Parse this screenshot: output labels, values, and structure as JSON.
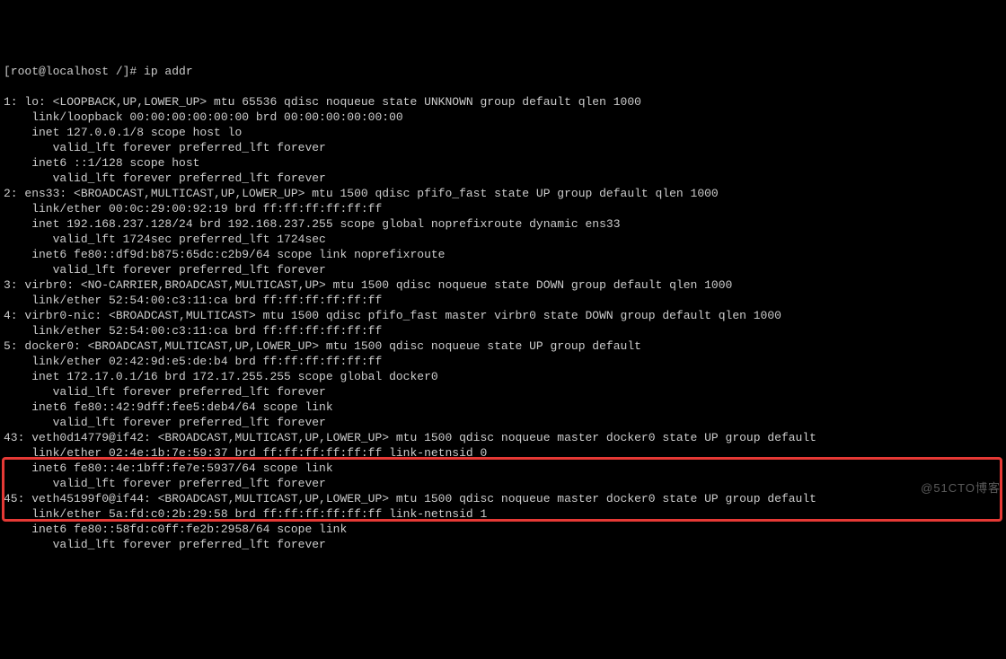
{
  "prompt": "[root@localhost /]# ip addr",
  "lines": [
    "1: lo: <LOOPBACK,UP,LOWER_UP> mtu 65536 qdisc noqueue state UNKNOWN group default qlen 1000",
    "    link/loopback 00:00:00:00:00:00 brd 00:00:00:00:00:00",
    "    inet 127.0.0.1/8 scope host lo",
    "       valid_lft forever preferred_lft forever",
    "    inet6 ::1/128 scope host",
    "       valid_lft forever preferred_lft forever",
    "2: ens33: <BROADCAST,MULTICAST,UP,LOWER_UP> mtu 1500 qdisc pfifo_fast state UP group default qlen 1000",
    "    link/ether 00:0c:29:00:92:19 brd ff:ff:ff:ff:ff:ff",
    "    inet 192.168.237.128/24 brd 192.168.237.255 scope global noprefixroute dynamic ens33",
    "       valid_lft 1724sec preferred_lft 1724sec",
    "    inet6 fe80::df9d:b875:65dc:c2b9/64 scope link noprefixroute",
    "       valid_lft forever preferred_lft forever",
    "3: virbr0: <NO-CARRIER,BROADCAST,MULTICAST,UP> mtu 1500 qdisc noqueue state DOWN group default qlen 1000",
    "    link/ether 52:54:00:c3:11:ca brd ff:ff:ff:ff:ff:ff",
    "4: virbr0-nic: <BROADCAST,MULTICAST> mtu 1500 qdisc pfifo_fast master virbr0 state DOWN group default qlen 1000",
    "    link/ether 52:54:00:c3:11:ca brd ff:ff:ff:ff:ff:ff",
    "5: docker0: <BROADCAST,MULTICAST,UP,LOWER_UP> mtu 1500 qdisc noqueue state UP group default",
    "    link/ether 02:42:9d:e5:de:b4 brd ff:ff:ff:ff:ff:ff",
    "    inet 172.17.0.1/16 brd 172.17.255.255 scope global docker0",
    "       valid_lft forever preferred_lft forever",
    "    inet6 fe80::42:9dff:fee5:deb4/64 scope link",
    "       valid_lft forever preferred_lft forever",
    "43: veth0d14779@if42: <BROADCAST,MULTICAST,UP,LOWER_UP> mtu 1500 qdisc noqueue master docker0 state UP group default",
    "    link/ether 02:4e:1b:7e:59:37 brd ff:ff:ff:ff:ff:ff link-netnsid 0",
    "    inet6 fe80::4e:1bff:fe7e:5937/64 scope link",
    "       valid_lft forever preferred_lft forever",
    "45: veth45199f0@if44: <BROADCAST,MULTICAST,UP,LOWER_UP> mtu 1500 qdisc noqueue master docker0 state UP group default",
    "    link/ether 5a:fd:c0:2b:29:58 brd ff:ff:ff:ff:ff:ff link-netnsid 1",
    "    inet6 fe80::58fd:c0ff:fe2b:2958/64 scope link",
    "       valid_lft forever preferred_lft forever"
  ],
  "watermark": "@51CTO博客"
}
